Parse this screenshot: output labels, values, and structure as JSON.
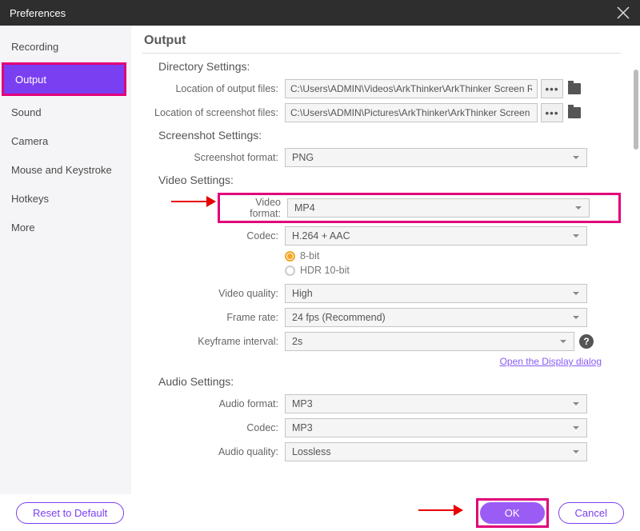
{
  "titlebar": {
    "title": "Preferences"
  },
  "sidebar": {
    "items": [
      {
        "label": "Recording"
      },
      {
        "label": "Output"
      },
      {
        "label": "Sound"
      },
      {
        "label": "Camera"
      },
      {
        "label": "Mouse and Keystroke"
      },
      {
        "label": "Hotkeys"
      },
      {
        "label": "More"
      }
    ]
  },
  "main": {
    "title": "Output",
    "directory": {
      "heading": "Directory Settings:",
      "output_label": "Location of output files:",
      "output_value": "C:\\Users\\ADMIN\\Videos\\ArkThinker\\ArkThinker Screen Rec",
      "screenshot_label": "Location of screenshot files:",
      "screenshot_value": "C:\\Users\\ADMIN\\Pictures\\ArkThinker\\ArkThinker Screen Re",
      "ellipsis": "•••"
    },
    "screenshot": {
      "heading": "Screenshot Settings:",
      "format_label": "Screenshot format:",
      "format_value": "PNG"
    },
    "video": {
      "heading": "Video Settings:",
      "format_label": "Video format:",
      "format_value": "MP4",
      "codec_label": "Codec:",
      "codec_value": "H.264 + AAC",
      "bit8": "8-bit",
      "hdr10": "HDR 10-bit",
      "quality_label": "Video quality:",
      "quality_value": "High",
      "framerate_label": "Frame rate:",
      "framerate_value": "24 fps (Recommend)",
      "keyframe_label": "Keyframe interval:",
      "keyframe_value": "2s",
      "link": "Open the Display dialog"
    },
    "audio": {
      "heading": "Audio Settings:",
      "format_label": "Audio format:",
      "format_value": "MP3",
      "codec_label": "Codec:",
      "codec_value": "MP3",
      "quality_label": "Audio quality:",
      "quality_value": "Lossless"
    }
  },
  "footer": {
    "reset": "Reset to Default",
    "ok": "OK",
    "cancel": "Cancel"
  }
}
